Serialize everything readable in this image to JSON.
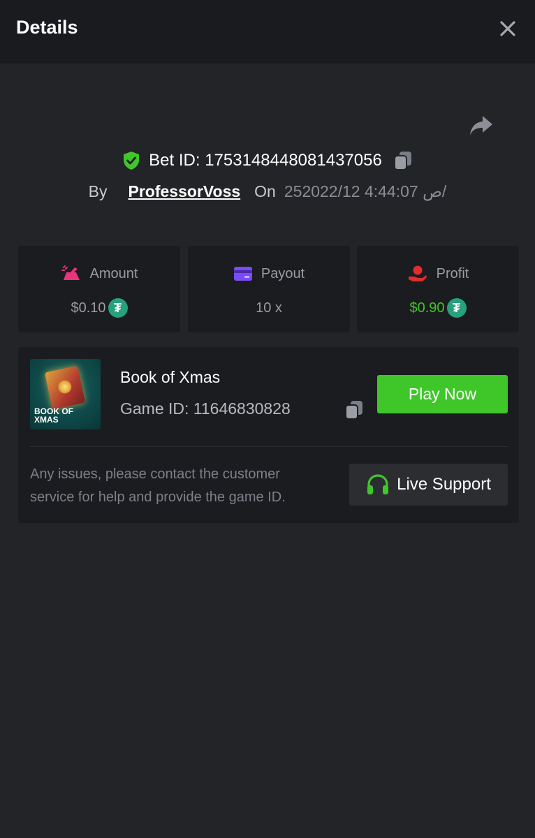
{
  "header": {
    "title": "Details",
    "close_icon": "close-icon"
  },
  "bet": {
    "share_icon": "share-icon",
    "id_label": "Bet ID: 1753148448081437056",
    "verified_icon": "shield-check-icon",
    "copy_icon": "copy-icon",
    "by_label": "By",
    "username": "ProfessorVoss",
    "on_label": "On",
    "date": "25ص 4:44:07 2022/12/"
  },
  "stats": [
    {
      "label": "Amount",
      "value": "$0.10",
      "icon": "bet-amount-icon",
      "icon_color": "#e8357d",
      "currency_icon": "tether-icon"
    },
    {
      "label": "Payout",
      "value": "10 x",
      "icon": "card-icon",
      "icon_color": "#7a4cf5"
    },
    {
      "label": "Profit",
      "value": "$0.90",
      "icon": "hand-coin-icon",
      "icon_color": "#e02d2d",
      "value_color": "#3fc72a",
      "currency_icon": "tether-icon"
    }
  ],
  "currency": {
    "symbol": "₮",
    "color": "#26a17b"
  },
  "game": {
    "name": "Book of Xmas",
    "id_label": "Game ID: 11646830828",
    "thumbnail_text_line1": "BOOK OF",
    "thumbnail_text_line2": "XMAS",
    "copy_icon": "copy-icon",
    "play_label": "Play Now",
    "help_text": "Any issues, please contact the customer service for help and provide the game ID.",
    "support_label": "Live Support",
    "support_icon": "headset-icon"
  },
  "colors": {
    "accent_green": "#3fc72a",
    "background": "#232427",
    "card": "#1b1c1f",
    "header": "#1a1b1e"
  }
}
